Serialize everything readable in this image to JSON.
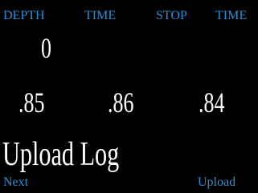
{
  "colors": {
    "background": "#000000",
    "label": "#2a8fd6",
    "value": "#ffffff"
  },
  "header": {
    "depth_label": "DEPTH",
    "time_label": "TIME",
    "stop_label": "STOP",
    "stop_time_label": "TIME"
  },
  "main": {
    "depth_value": "0",
    "readings": [
      ".85",
      ".86",
      ".84"
    ],
    "title": "Upload Log"
  },
  "softkeys": {
    "left": "Next",
    "right": "Upload"
  }
}
